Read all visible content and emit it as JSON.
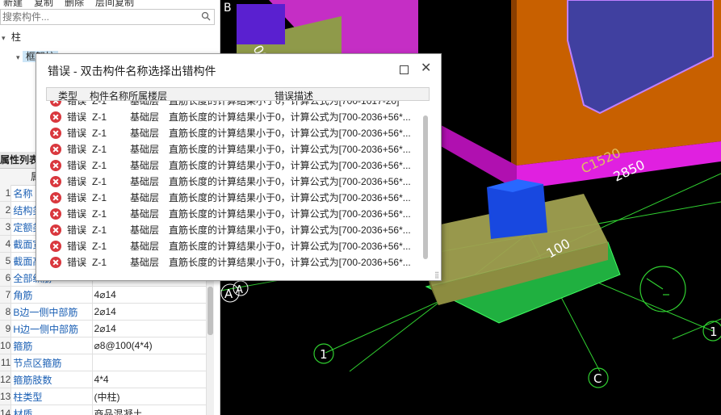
{
  "toolbar": {
    "items": [
      "新建",
      "复制",
      "删除",
      "层间复制"
    ]
  },
  "search": {
    "placeholder": "搜索构件..."
  },
  "tree": {
    "root": "柱",
    "child": "框架柱"
  },
  "attr": {
    "header": "属性列表",
    "subheader": "属",
    "rows": [
      {
        "num": "1",
        "name": "名称",
        "value": ""
      },
      {
        "num": "2",
        "name": "结构类",
        "value": ""
      },
      {
        "num": "3",
        "name": "定额类",
        "value": ""
      },
      {
        "num": "4",
        "name": "截面宽",
        "value": ""
      },
      {
        "num": "5",
        "name": "截面高",
        "value": ""
      },
      {
        "num": "6",
        "name": "全部纵筋",
        "value": ""
      },
      {
        "num": "7",
        "name": "角筋",
        "value": "4⌀14"
      },
      {
        "num": "8",
        "name": "B边一侧中部筋",
        "value": "2⌀14"
      },
      {
        "num": "9",
        "name": "H边一侧中部筋",
        "value": "2⌀14"
      },
      {
        "num": "10",
        "name": "箍筋",
        "value": "⌀8@100(4*4)"
      },
      {
        "num": "11",
        "name": "节点区箍筋",
        "value": ""
      },
      {
        "num": "12",
        "name": "箍筋肢数",
        "value": "4*4"
      },
      {
        "num": "13",
        "name": "柱类型",
        "value": "(中柱)"
      },
      {
        "num": "14",
        "name": "材质",
        "value": "商品混凝土"
      }
    ]
  },
  "viewport": {
    "labels": {
      "axis_b": "B",
      "axis_a": "A",
      "axis_a2": "A",
      "axis_1": "1",
      "axis_c": "C",
      "axis_1b": "1",
      "dim_100": "100",
      "dim_2850": "2850",
      "dim_c1520": "C1520",
      "dim_00": "00"
    }
  },
  "dialog": {
    "title": "错误 - 双击构件名称选择出错构件",
    "columns": [
      "类型",
      "构件名称",
      "所属楼层",
      "错误描述"
    ],
    "rows": [
      {
        "type": "错误",
        "name": "Z-1",
        "floor": "基础层",
        "desc": "直筋长度的计算结果小于0，计算公式为[700-1017-20]"
      },
      {
        "type": "错误",
        "name": "Z-1",
        "floor": "基础层",
        "desc": "直筋长度的计算结果小于0，计算公式为[700-2036+56*..."
      },
      {
        "type": "错误",
        "name": "Z-1",
        "floor": "基础层",
        "desc": "直筋长度的计算结果小于0，计算公式为[700-2036+56*..."
      },
      {
        "type": "错误",
        "name": "Z-1",
        "floor": "基础层",
        "desc": "直筋长度的计算结果小于0，计算公式为[700-2036+56*..."
      },
      {
        "type": "错误",
        "name": "Z-1",
        "floor": "基础层",
        "desc": "直筋长度的计算结果小于0，计算公式为[700-2036+56*..."
      },
      {
        "type": "错误",
        "name": "Z-1",
        "floor": "基础层",
        "desc": "直筋长度的计算结果小于0，计算公式为[700-2036+56*..."
      },
      {
        "type": "错误",
        "name": "Z-1",
        "floor": "基础层",
        "desc": "直筋长度的计算结果小于0，计算公式为[700-2036+56*..."
      },
      {
        "type": "错误",
        "name": "Z-1",
        "floor": "基础层",
        "desc": "直筋长度的计算结果小于0，计算公式为[700-2036+56*..."
      },
      {
        "type": "错误",
        "name": "Z-1",
        "floor": "基础层",
        "desc": "直筋长度的计算结果小于0，计算公式为[700-2036+56*..."
      },
      {
        "type": "错误",
        "name": "Z-1",
        "floor": "基础层",
        "desc": "直筋长度的计算结果小于0，计算公式为[700-2036+56*..."
      },
      {
        "type": "错误",
        "name": "Z-1",
        "floor": "基础层",
        "desc": "直筋长度的计算结果小于0，计算公式为[700-2036+56*..."
      }
    ]
  },
  "colors": {
    "error_red": "#d9383e",
    "link_blue": "#1a5fb4",
    "magenta": "#e020e0",
    "orange_wall": "#c86000",
    "grid_green": "#30d030"
  }
}
